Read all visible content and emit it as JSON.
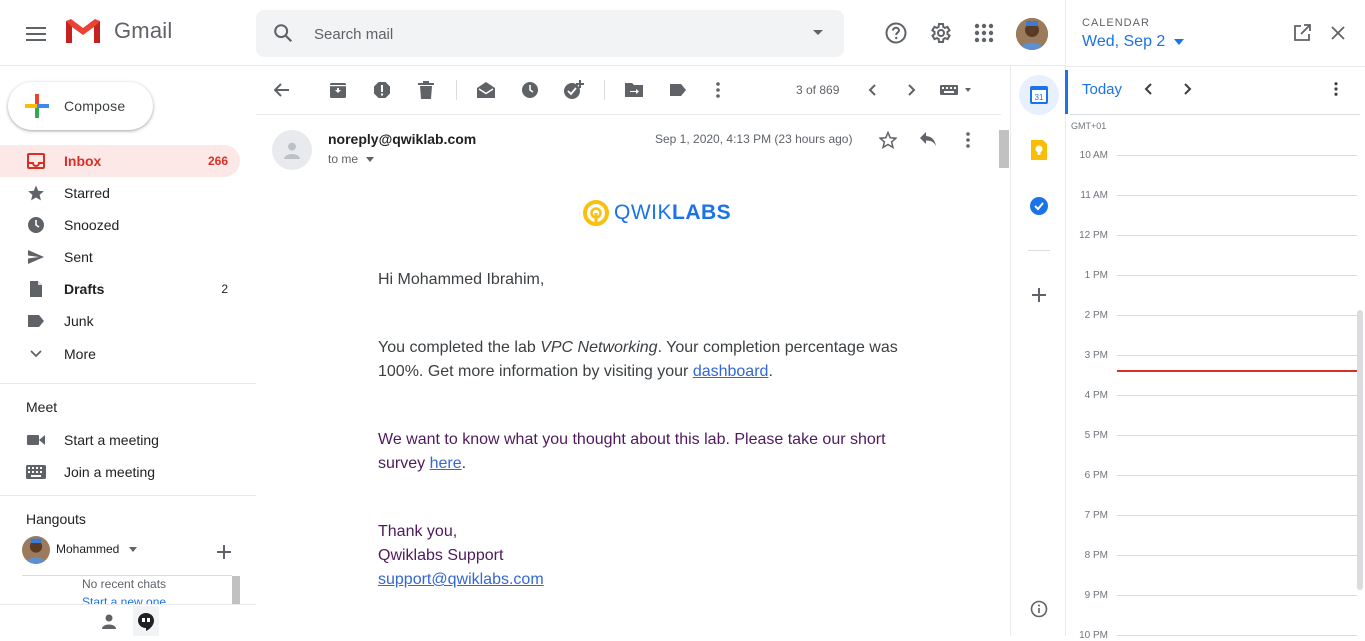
{
  "app": {
    "name": "Gmail"
  },
  "search": {
    "placeholder": "Search mail"
  },
  "compose": {
    "label": "Compose"
  },
  "nav": [
    {
      "label": "Inbox",
      "count": "266"
    },
    {
      "label": "Starred",
      "count": ""
    },
    {
      "label": "Snoozed",
      "count": ""
    },
    {
      "label": "Sent",
      "count": ""
    },
    {
      "label": "Drafts",
      "count": "2"
    },
    {
      "label": "Junk",
      "count": ""
    },
    {
      "label": "More",
      "count": ""
    }
  ],
  "meet": {
    "title": "Meet",
    "start": "Start a meeting",
    "join": "Join a meeting"
  },
  "hangouts": {
    "title": "Hangouts",
    "user": "Mohammed",
    "no_chats": "No recent chats",
    "start_new": "Start a new one"
  },
  "toolbar": {
    "count": "3 of 869"
  },
  "message": {
    "sender": "noreply@qwiklab.com",
    "to": "to me",
    "date": "Sep 1, 2020, 4:13 PM (23 hours ago)",
    "logo_text_a": "QWIK",
    "logo_text_b": "LABS",
    "greeting": "Hi Mohammed Ibrahim,",
    "p1_a": "You completed the lab ",
    "p1_lab": "VPC Networking",
    "p1_b": ". Your completion percentage was",
    "p1_c": "100%. Get more information by visiting your ",
    "p1_link": "dashboard",
    "p1_end": ".",
    "p2_a": "We want to know what you thought about this lab. Please take our short",
    "p2_b": "survey ",
    "p2_link": "here",
    "p2_end": ".",
    "sign1": "Thank you,",
    "sign2": "Qwiklabs Support",
    "sign_link": "support@qwiklabs.com"
  },
  "calendar": {
    "label": "CALENDAR",
    "date": "Wed, Sep 2",
    "today": "Today",
    "timezone": "GMT+01",
    "hours": [
      "10 AM",
      "11 AM",
      "12 PM",
      "1 PM",
      "2 PM",
      "3 PM",
      "4 PM",
      "5 PM",
      "6 PM",
      "7 PM",
      "8 PM",
      "9 PM",
      "10 PM"
    ]
  },
  "addons": {
    "calendar_day": "31"
  },
  "colors": {
    "gmail_red": "#d93025",
    "accent_blue": "#1a73e8",
    "inbox_bg": "#fce8e6",
    "qwiklabs_yellow": "#f9c00f",
    "qwiklabs_blue": "#1a73e8"
  }
}
